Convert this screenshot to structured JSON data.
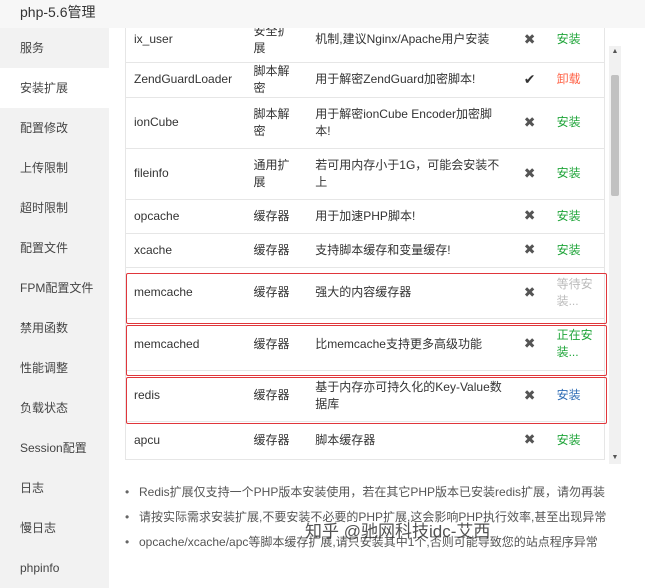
{
  "window": {
    "title": "php-5.6管理"
  },
  "sidebar": {
    "items": [
      {
        "label": "服务"
      },
      {
        "label": "安装扩展",
        "active": true
      },
      {
        "label": "配置修改"
      },
      {
        "label": "上传限制"
      },
      {
        "label": "超时限制"
      },
      {
        "label": "配置文件"
      },
      {
        "label": "FPM配置文件"
      },
      {
        "label": "禁用函数"
      },
      {
        "label": "性能调整"
      },
      {
        "label": "负载状态"
      },
      {
        "label": "Session配置"
      },
      {
        "label": "日志"
      },
      {
        "label": "慢日志"
      },
      {
        "label": "phpinfo"
      }
    ]
  },
  "extensions": {
    "rows": [
      {
        "name": "ix_user",
        "type": "安全扩展",
        "desc": "机制,建议Nginx/Apache用户安装",
        "status": "cross",
        "op": "安装",
        "op_kind": "install"
      },
      {
        "name": "ZendGuardLoader",
        "type": "脚本解密",
        "desc": "用于解密ZendGuard加密脚本!",
        "status": "check",
        "op": "卸载",
        "op_kind": "uninstall"
      },
      {
        "name": "ionCube",
        "type": "脚本解密",
        "desc": "用于解密ionCube Encoder加密脚本!",
        "status": "cross",
        "op": "安装",
        "op_kind": "install"
      },
      {
        "name": "fileinfo",
        "type": "通用扩展",
        "desc": "若可用内存小于1G，可能会安装不上",
        "status": "cross",
        "op": "安装",
        "op_kind": "install"
      },
      {
        "name": "opcache",
        "type": "缓存器",
        "desc": "用于加速PHP脚本!",
        "status": "cross",
        "op": "安装",
        "op_kind": "install"
      },
      {
        "name": "xcache",
        "type": "缓存器",
        "desc": "支持脚本缓存和变量缓存!",
        "status": "cross",
        "op": "安装",
        "op_kind": "install"
      },
      {
        "name": "memcache",
        "type": "缓存器",
        "desc": "强大的内容缓存器",
        "status": "cross",
        "op": "等待安装...",
        "op_kind": "waiting"
      },
      {
        "name": "memcached",
        "type": "缓存器",
        "desc": "比memcache支持更多高级功能",
        "status": "cross",
        "op": "正在安装...",
        "op_kind": "running"
      },
      {
        "name": "redis",
        "type": "缓存器",
        "desc": "基于内存亦可持久化的Key-Value数据库",
        "status": "cross",
        "op": "安装",
        "op_kind": "blue"
      },
      {
        "name": "apcu",
        "type": "缓存器",
        "desc": "脚本缓存器",
        "status": "cross",
        "op": "安装",
        "op_kind": "install"
      }
    ]
  },
  "notes": [
    "Redis扩展仅支持一个PHP版本安装使用，若在其它PHP版本已安装redis扩展，请勿再装",
    "请按实际需求安装扩展,不要安装不必要的PHP扩展,这会影响PHP执行效率,甚至出现异常",
    "opcache/xcache/apc等脚本缓存扩展,请只安装其中1个,否则可能导致您的站点程序异常"
  ],
  "watermark": "知乎 @驰网科技idc-艾西",
  "icons": {
    "check": "✔",
    "cross": "✖",
    "scroll_up": "▲",
    "scroll_down": "▼"
  },
  "colors": {
    "install": "#20a53a",
    "uninstall": "#ff6347",
    "highlight_border": "#e0363b",
    "sidebar_bg": "#f2f2f2"
  }
}
